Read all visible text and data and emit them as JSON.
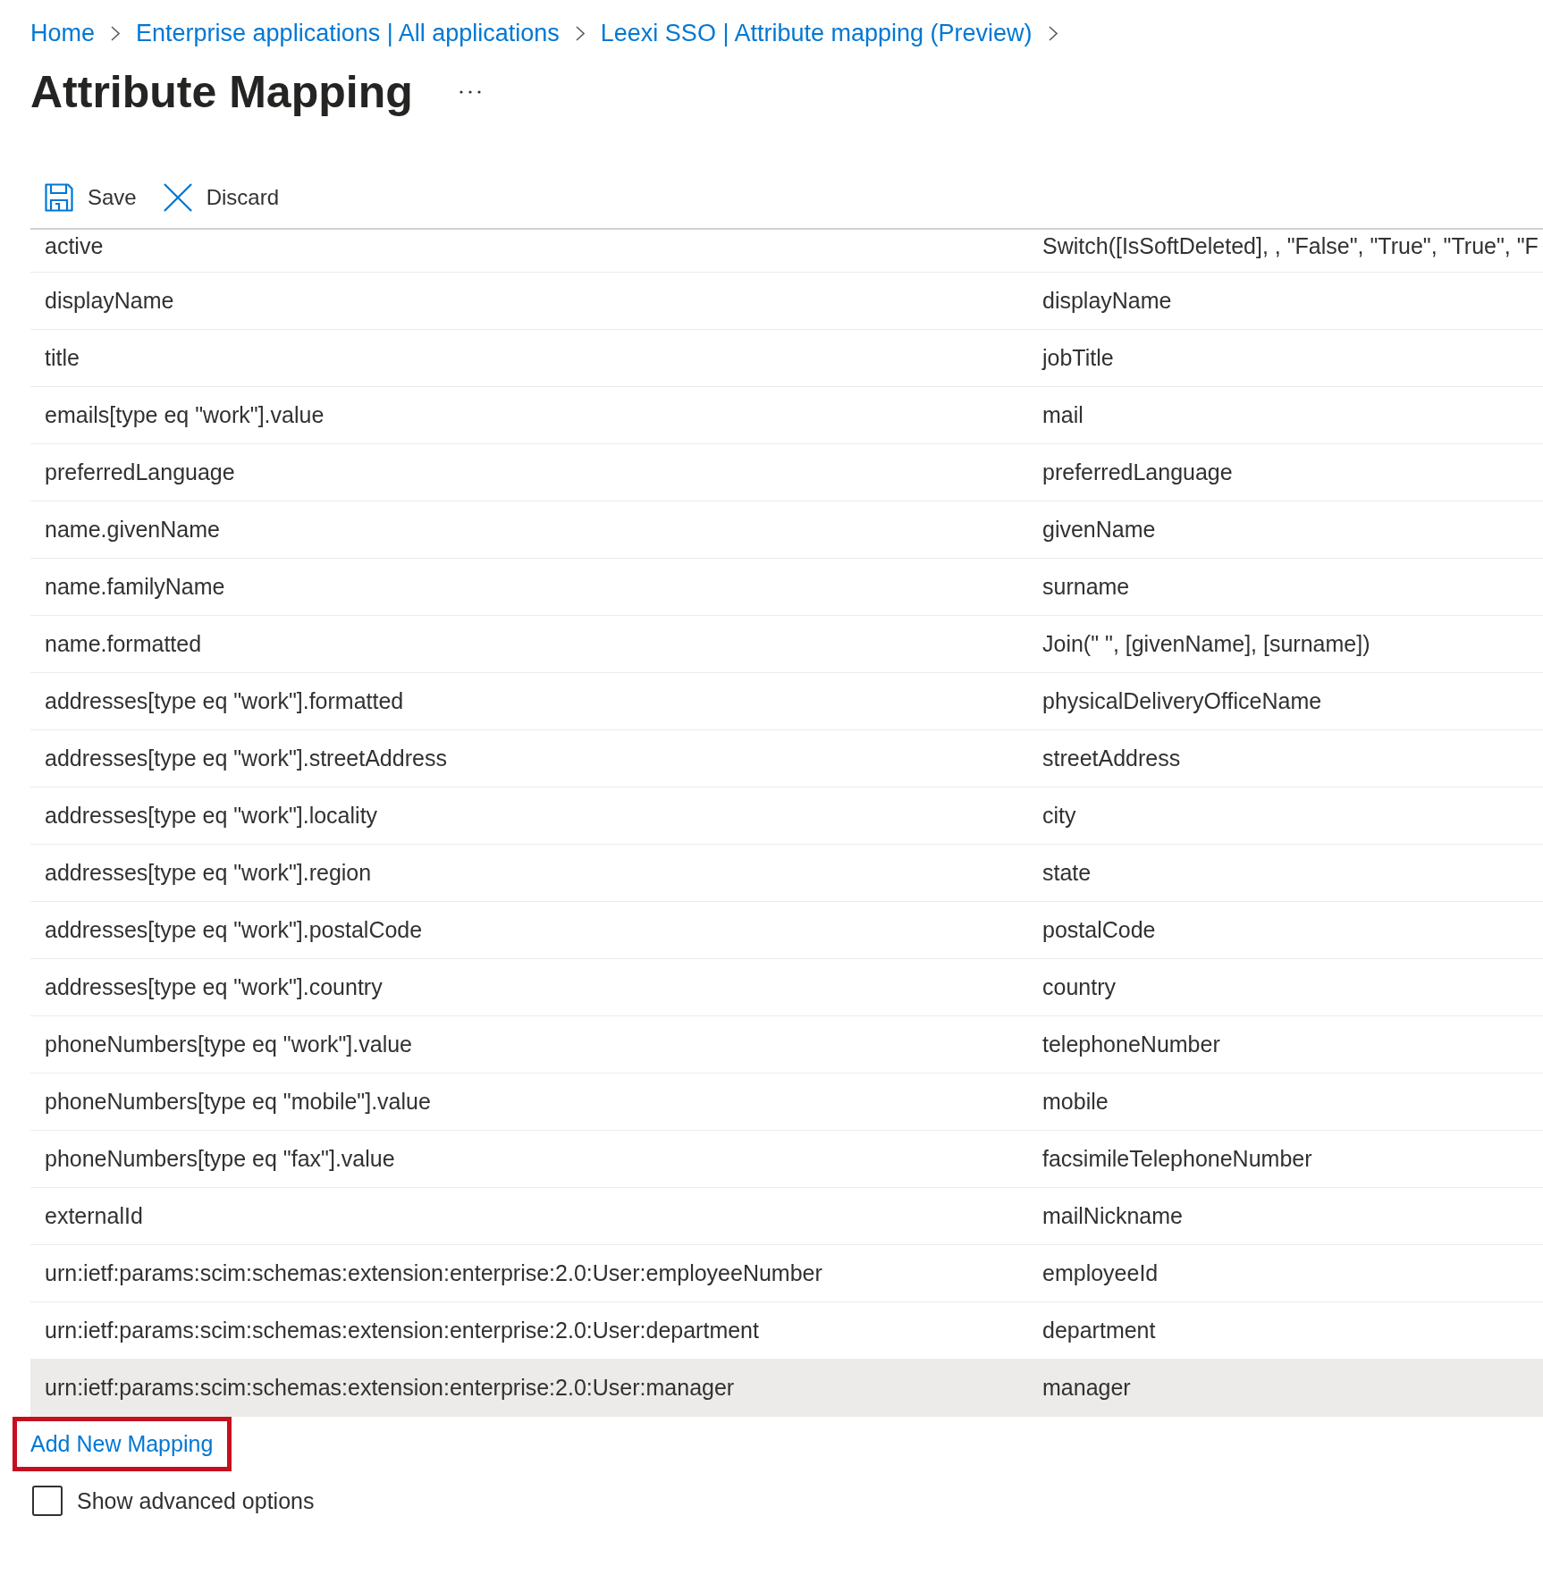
{
  "breadcrumb": [
    {
      "label": "Home"
    },
    {
      "label": "Enterprise applications | All applications"
    },
    {
      "label": "Leexi SSO | Attribute mapping (Preview)"
    }
  ],
  "page": {
    "title": "Attribute Mapping"
  },
  "toolbar": {
    "buttons": [
      {
        "kind": "save",
        "label": "Save"
      },
      {
        "kind": "discard",
        "label": "Discard"
      }
    ]
  },
  "mappings": {
    "rows": [
      {
        "column_1": "active",
        "column_2": "Switch([IsSoftDeleted], , \"False\", \"True\", \"True\", \"F",
        "selected": false
      },
      {
        "column_1": "displayName",
        "column_2": "displayName",
        "selected": false
      },
      {
        "column_1": "title",
        "column_2": "jobTitle",
        "selected": false
      },
      {
        "column_1": "emails[type eq \"work\"].value",
        "column_2": "mail",
        "selected": false
      },
      {
        "column_1": "preferredLanguage",
        "column_2": "preferredLanguage",
        "selected": false
      },
      {
        "column_1": "name.givenName",
        "column_2": "givenName",
        "selected": false
      },
      {
        "column_1": "name.familyName",
        "column_2": "surname",
        "selected": false
      },
      {
        "column_1": "name.formatted",
        "column_2": "Join(\" \", [givenName], [surname])",
        "selected": false
      },
      {
        "column_1": "addresses[type eq \"work\"].formatted",
        "column_2": "physicalDeliveryOfficeName",
        "selected": false
      },
      {
        "column_1": "addresses[type eq \"work\"].streetAddress",
        "column_2": "streetAddress",
        "selected": false
      },
      {
        "column_1": "addresses[type eq \"work\"].locality",
        "column_2": "city",
        "selected": false
      },
      {
        "column_1": "addresses[type eq \"work\"].region",
        "column_2": "state",
        "selected": false
      },
      {
        "column_1": "addresses[type eq \"work\"].postalCode",
        "column_2": "postalCode",
        "selected": false
      },
      {
        "column_1": "addresses[type eq \"work\"].country",
        "column_2": "country",
        "selected": false
      },
      {
        "column_1": "phoneNumbers[type eq \"work\"].value",
        "column_2": "telephoneNumber",
        "selected": false
      },
      {
        "column_1": "phoneNumbers[type eq \"mobile\"].value",
        "column_2": "mobile",
        "selected": false
      },
      {
        "column_1": "phoneNumbers[type eq \"fax\"].value",
        "column_2": "facsimileTelephoneNumber",
        "selected": false
      },
      {
        "column_1": "externalId",
        "column_2": "mailNickname",
        "selected": false
      },
      {
        "column_1": "urn:ietf:params:scim:schemas:extension:enterprise:2.0:User:employeeNumber",
        "column_2": "employeeId",
        "selected": false
      },
      {
        "column_1": "urn:ietf:params:scim:schemas:extension:enterprise:2.0:User:department",
        "column_2": "department",
        "selected": false
      },
      {
        "column_1": "urn:ietf:params:scim:schemas:extension:enterprise:2.0:User:manager",
        "column_2": "manager",
        "selected": true
      }
    ]
  },
  "add_mapping": {
    "label": "Add New Mapping",
    "highlighted": true
  },
  "advanced_options": {
    "label": "Show advanced options",
    "checked": false
  }
}
